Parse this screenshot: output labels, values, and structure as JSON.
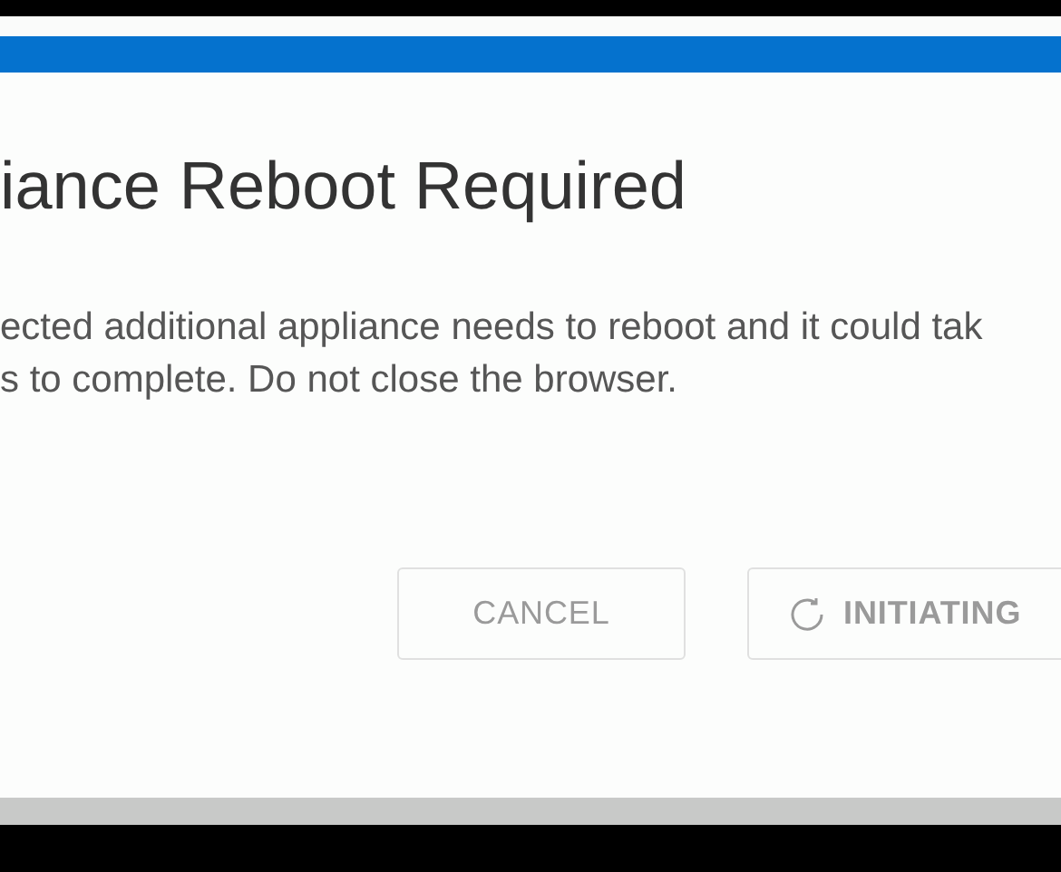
{
  "dialog": {
    "title": "iance Reboot Required",
    "body_lines": [
      "ected additional appliance needs to reboot and it could tak",
      "s to complete. Do not close the browser."
    ],
    "buttons": [
      {
        "label": "CANCEL",
        "kind": "plain",
        "disabled": true
      },
      {
        "label": "INITIATING",
        "kind": "spinner",
        "disabled": true
      }
    ]
  }
}
